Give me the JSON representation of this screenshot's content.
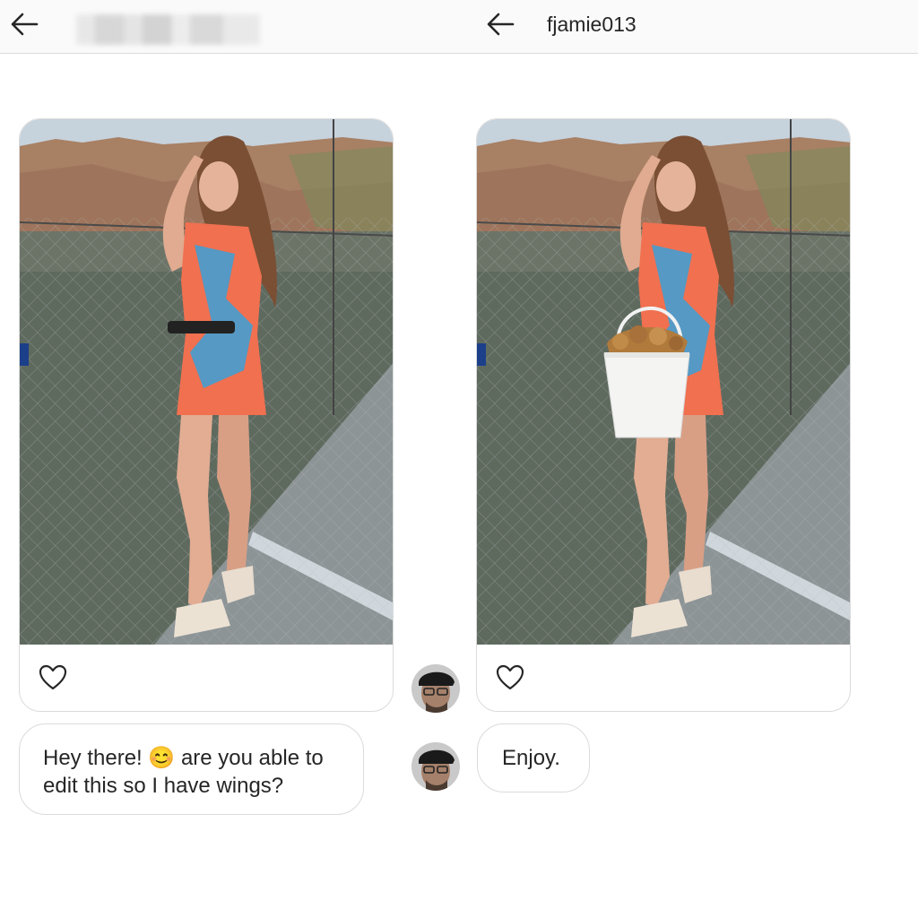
{
  "left_thread": {
    "header_name_blurred": true,
    "message": {
      "text_before": "Hey there! ",
      "emoji": "😊",
      "text_after": " are you able to edit this so I have wings?"
    }
  },
  "right_thread": {
    "header": {
      "username": "fjamie013"
    },
    "reply": {
      "text": "Enjoy."
    }
  },
  "icons": {
    "back": "arrow-left-icon",
    "like": "heart-outline-icon"
  },
  "colors": {
    "text": "#262626",
    "border": "#dbdbdb",
    "header_bg": "#fafafa"
  }
}
